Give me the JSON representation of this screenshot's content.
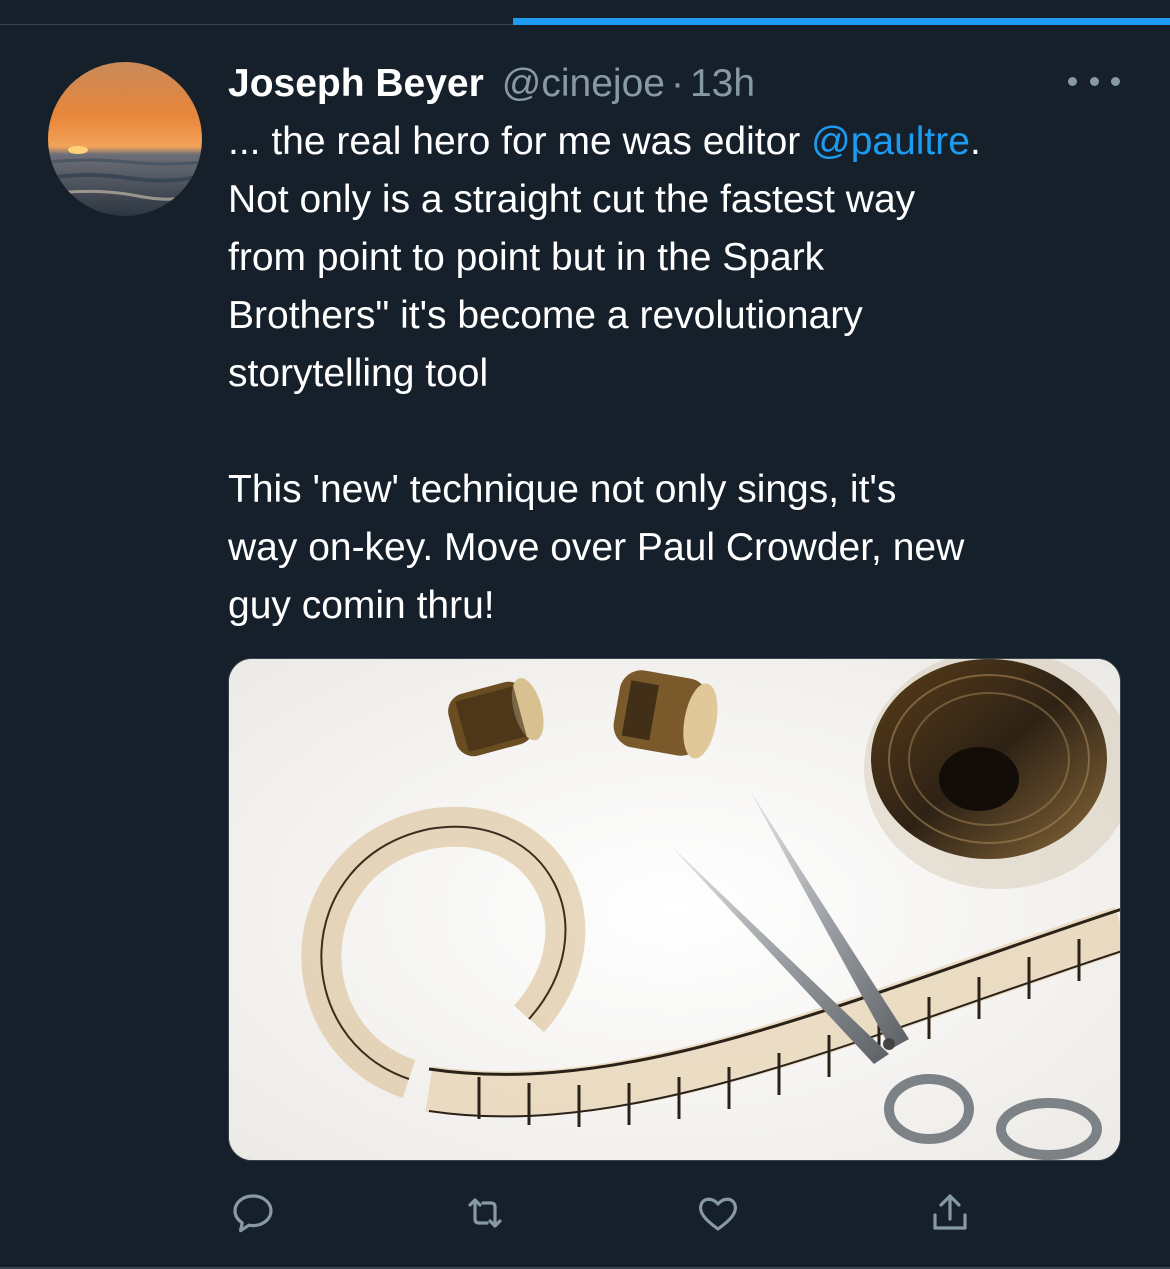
{
  "tweet": {
    "author_name": "Joseph Beyer",
    "author_handle": "@cinejoe",
    "separator": "·",
    "time_ago": "13h",
    "text_part1": "... the real hero for me was editor ",
    "mention": "@paultre",
    "text_part2": ".\nNot only is a straight cut the fastest way\nfrom point to point but in the Spark\nBrothers\" it's become a revolutionary\nstorytelling tool\n\nThis 'new' technique not only sings, it's\nway on-key. Move over Paul Crowder, new\nguy comin thru!"
  },
  "icons": {
    "more": "more-horizontal-icon",
    "reply": "reply-icon",
    "retweet": "retweet-icon",
    "like": "heart-icon",
    "share": "share-icon"
  },
  "colors": {
    "background": "#15202b",
    "accent": "#1d9bf0",
    "muted": "#8899a6",
    "text": "#ffffff"
  }
}
